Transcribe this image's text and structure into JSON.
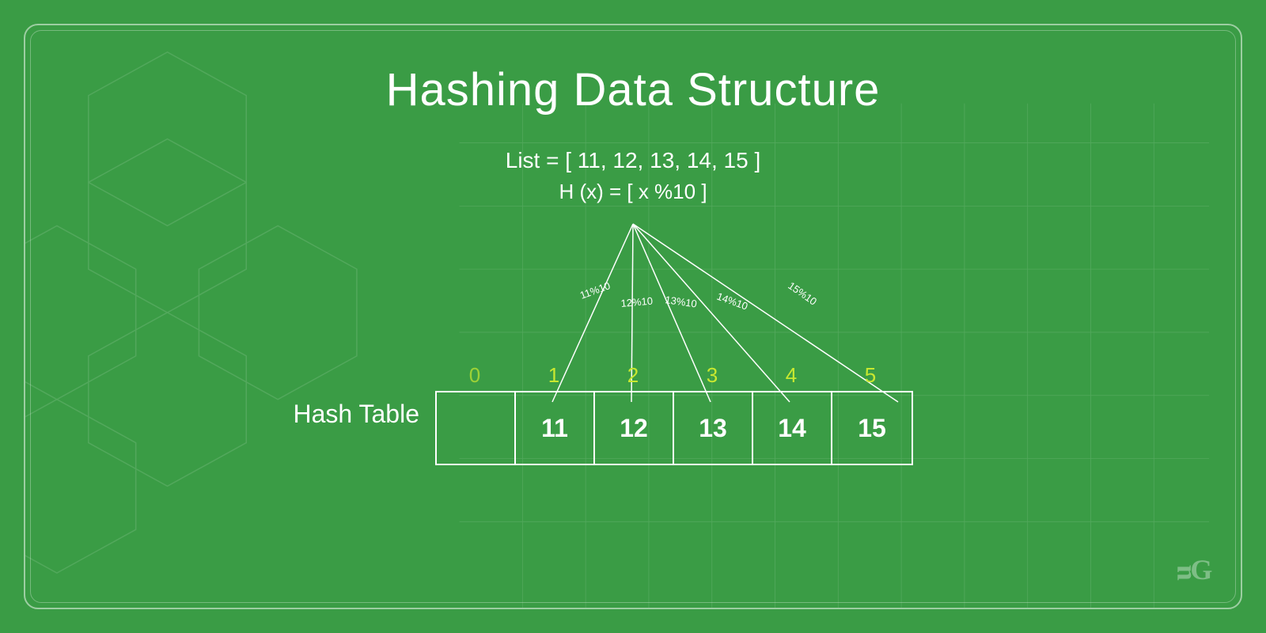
{
  "title": "Hashing Data Structure",
  "list_formula": "List = [ 11, 12, 13, 14, 15 ]",
  "hash_formula": "H (x) = [ x %10 ]",
  "hash_table_label": "Hash Table",
  "indices": [
    "0",
    "1",
    "2",
    "3",
    "4",
    "5"
  ],
  "cells": [
    "",
    "11",
    "12",
    "13",
    "14",
    "15"
  ],
  "modulo_labels": [
    "11%10",
    "12%10",
    "13%10",
    "14%10",
    "15%10"
  ],
  "colors": {
    "background": "#3a9c45",
    "accent_yellow": "#c8e830",
    "white": "#ffffff"
  },
  "gfg_logo": "ᴝG"
}
